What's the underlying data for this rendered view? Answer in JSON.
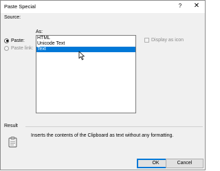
{
  "titlebar": {
    "title": "Paste Special",
    "help": "?",
    "close": "✕"
  },
  "source_label": "Source:",
  "as_label": "As:",
  "options": [
    {
      "label": "Paste:",
      "checked": true,
      "disabled": false
    },
    {
      "label": "Paste link:",
      "checked": false,
      "disabled": true
    }
  ],
  "formats": [
    {
      "label": "HTML",
      "selected": false
    },
    {
      "label": "Unicode Text",
      "selected": false
    },
    {
      "label": "Text",
      "selected": true
    }
  ],
  "display_as_icon": {
    "label": "Display as icon",
    "checked": false,
    "disabled": true
  },
  "result": {
    "label": "Result",
    "text": "Inserts the contents of the Clipboard as text without any formatting.",
    "icon": "clipboard-icon"
  },
  "buttons": {
    "ok": "OK",
    "cancel": "Cancel"
  },
  "colors": {
    "selection": "#0078d7",
    "dialog_bg": "#f0f0f0"
  }
}
